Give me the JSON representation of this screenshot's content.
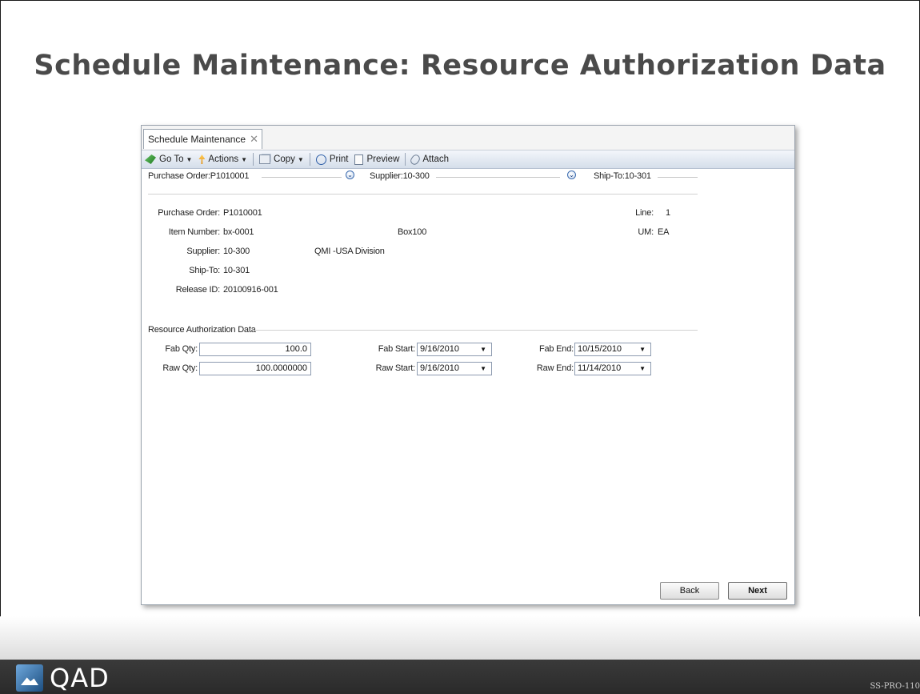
{
  "slide": {
    "title": "Schedule Maintenance: Resource Authorization Data",
    "brand": "QAD",
    "code": "SS-PRO-110"
  },
  "window": {
    "tab_label": "Schedule Maintenance",
    "tab_close": "✕",
    "toolbar": {
      "goto": "Go To",
      "actions": "Actions",
      "copy": "Copy",
      "print": "Print",
      "preview": "Preview",
      "attach": "Attach"
    },
    "header": {
      "purchase_order": "Purchase Order:P1010001",
      "supplier": "Supplier:10-300",
      "ship_to": "Ship-To:10-301"
    },
    "details": {
      "purchase_order_label": "Purchase Order:",
      "purchase_order_value": "P1010001",
      "line_label": "Line:",
      "line_value": "1",
      "item_number_label": "Item Number:",
      "item_number_value": "bx-0001",
      "item_description": "Box100",
      "um_label": "UM:",
      "um_value": "EA",
      "supplier_label": "Supplier:",
      "supplier_value": "10-300",
      "supplier_name": "QMI -USA Division",
      "ship_to_label": "Ship-To:",
      "ship_to_value": "10-301",
      "release_id_label": "Release ID:",
      "release_id_value": "20100916-001"
    },
    "resource_auth": {
      "section_title": "Resource Authorization Data",
      "fab_qty_label": "Fab Qty:",
      "fab_qty_value": "100.0",
      "raw_qty_label": "Raw Qty:",
      "raw_qty_value": "100.0000000",
      "fab_start_label": "Fab Start:",
      "fab_start_value": "9/16/2010",
      "raw_start_label": "Raw Start:",
      "raw_start_value": "9/16/2010",
      "fab_end_label": "Fab End:",
      "fab_end_value": "10/15/2010",
      "raw_end_label": "Raw End:",
      "raw_end_value": "11/14/2010"
    },
    "buttons": {
      "back": "Back",
      "next": "Next"
    }
  },
  "icons": [
    "goto-icon",
    "actions-icon",
    "copy-icon",
    "print-icon",
    "preview-icon",
    "attach-icon",
    "expand-icon",
    "dropdown-arrow-icon",
    "close-icon"
  ]
}
